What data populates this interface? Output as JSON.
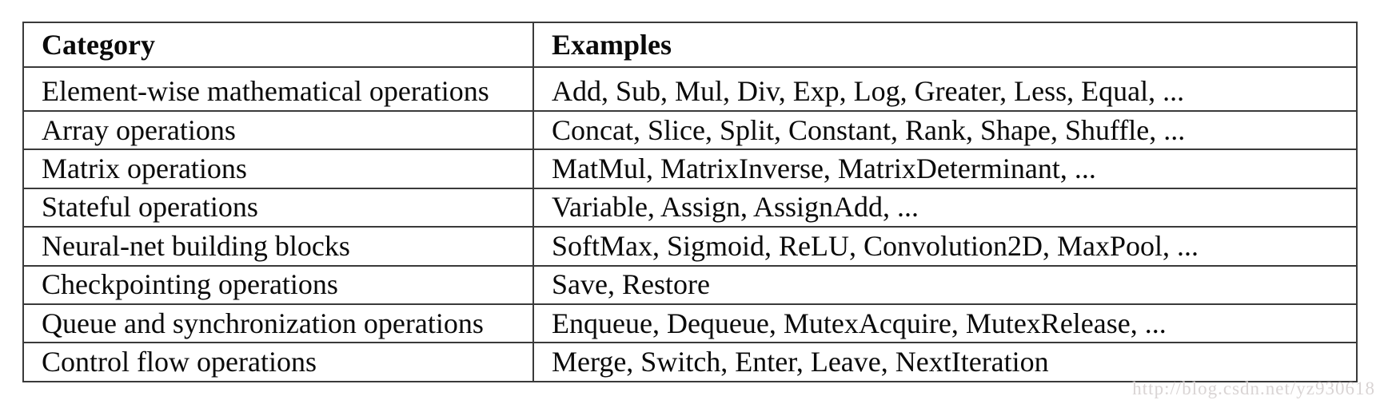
{
  "table": {
    "headers": {
      "category": "Category",
      "examples": "Examples"
    },
    "rows": [
      {
        "category": "Element-wise mathematical operations",
        "examples": "Add, Sub, Mul, Div, Exp, Log, Greater, Less, Equal, ..."
      },
      {
        "category": "Array operations",
        "examples": "Concat, Slice, Split, Constant, Rank, Shape, Shuffle, ..."
      },
      {
        "category": "Matrix operations",
        "examples": "MatMul, MatrixInverse, MatrixDeterminant, ..."
      },
      {
        "category": "Stateful operations",
        "examples": "Variable, Assign, AssignAdd, ..."
      },
      {
        "category": "Neural-net building blocks",
        "examples": "SoftMax, Sigmoid, ReLU, Convolution2D, MaxPool, ..."
      },
      {
        "category": "Checkpointing operations",
        "examples": "Save, Restore"
      },
      {
        "category": "Queue and synchronization operations",
        "examples": "Enqueue, Dequeue, MutexAcquire, MutexRelease, ..."
      },
      {
        "category": "Control flow operations",
        "examples": "Merge, Switch, Enter, Leave, NextIteration"
      }
    ]
  },
  "watermark": {
    "text": "http://blog.csdn.net/yz930618"
  },
  "colors": {
    "text": "#0a0a0a",
    "border": "#3a3a3a",
    "background": "#ffffff",
    "watermark": "#d9d4d4"
  }
}
